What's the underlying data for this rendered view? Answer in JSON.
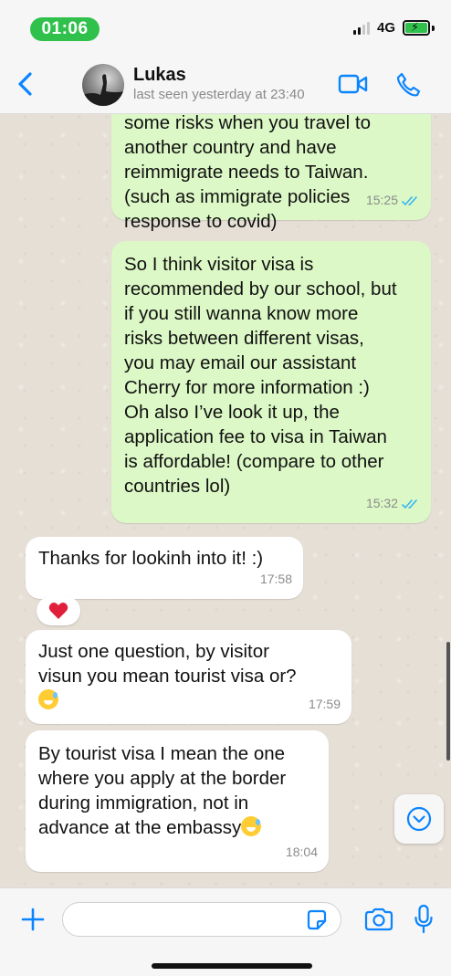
{
  "status_bar": {
    "time": "01:06",
    "network": "4G"
  },
  "header": {
    "back_icon": "chevron-left-icon",
    "contact_name": "Lukas",
    "last_seen": "last seen yesterday at 23:40",
    "video_icon": "video-camera-icon",
    "call_icon": "phone-icon"
  },
  "messages": [
    {
      "direction": "outgoing",
      "text": "some risks when you travel to\nanother country and have\nreimmigrate needs to Taiwan.\n(such as immigrate policies\nresponse to covid)",
      "time": "15:25",
      "status": "read"
    },
    {
      "direction": "outgoing",
      "text": "So I think visitor visa is\nrecommended by our school, but\nif you still wanna know more\nrisks between different visas,\nyou may email our assistant\nCherry for more information :)\nOh also I’ve look it up, the\napplication fee to visa in Taiwan\nis affordable! (compare to other\ncountries lol)",
      "time": "15:32",
      "status": "read"
    },
    {
      "direction": "incoming",
      "text": "Thanks for lookinh into it! :)",
      "time": "17:58",
      "reaction": "heart"
    },
    {
      "direction": "incoming",
      "text": "Just one question, by visitor\nvisun you mean tourist visa or?",
      "time": "17:59",
      "emoji": "grinning-sweat"
    },
    {
      "direction": "incoming",
      "text": "By tourist visa I mean the one\nwhere you apply at the border\nduring immigration, not in\nadvance at the embassy",
      "time": "18:04",
      "emoji": "grinning-sweat"
    }
  ],
  "composer": {
    "placeholder": "",
    "plus_icon": "plus-icon",
    "sticker_icon": "sticker-icon",
    "camera_icon": "camera-icon",
    "mic_icon": "microphone-icon"
  },
  "colors": {
    "accent": "#0a84ff",
    "outgoing_bubble": "#dcf8c6",
    "incoming_bubble": "#ffffff",
    "time_pill": "#30c14c",
    "read_ticks": "#34b7f1",
    "heart": "#e0203a"
  }
}
